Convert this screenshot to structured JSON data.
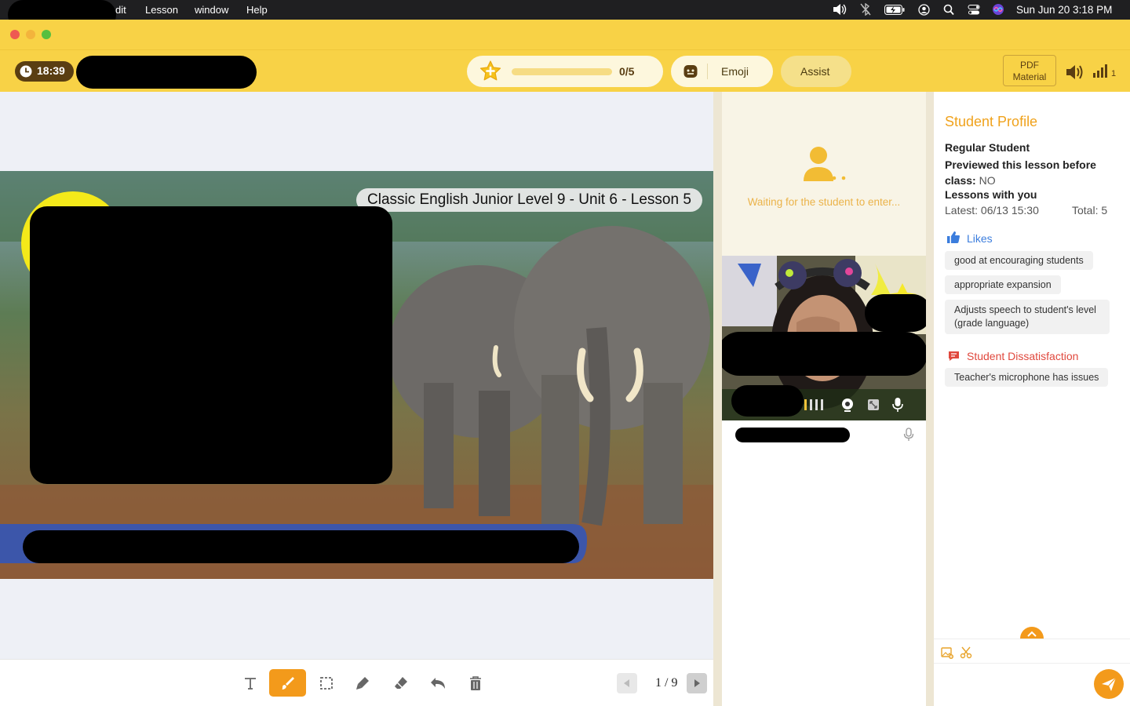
{
  "menubar": {
    "items": [
      "dit",
      "Lesson",
      "window",
      "Help"
    ],
    "clock": "Sun Jun 20  3:18 PM"
  },
  "toolbar": {
    "timer": "18:39",
    "stars": "0/5",
    "emoji_label": "Emoji",
    "assist_label": "Assist",
    "pdf_line1": "PDF",
    "pdf_line2": "Material",
    "signal_count": "1"
  },
  "slide": {
    "title": "Classic English Junior Level 9 - Unit 6 - Lesson 5"
  },
  "pager": {
    "current": "1",
    "total": "9",
    "sep": "/"
  },
  "video": {
    "waiting_text": "Waiting for the student to enter..."
  },
  "profile": {
    "title": "Student Profile",
    "student_type": "Regular Student",
    "previewed_label": "Previewed this lesson before class:",
    "previewed_value": "NO",
    "lessons_label": "Lessons with you",
    "latest": "Latest: 06/13 15:30",
    "total": "Total: 5",
    "likes_title": "Likes",
    "likes": [
      "good at encouraging students",
      "appropriate expansion",
      "Adjusts speech to student's level (grade language)"
    ],
    "dissatisfaction_title": "Student Dissatisfaction",
    "dissatisfaction": [
      "Teacher's microphone has issues"
    ]
  },
  "colors": {
    "brand_yellow": "#f8d246",
    "accent_orange": "#f39a1b",
    "profile_title": "#f0a21c",
    "likes_blue": "#3b7ddd",
    "dissatisfaction_red": "#e0483d"
  }
}
